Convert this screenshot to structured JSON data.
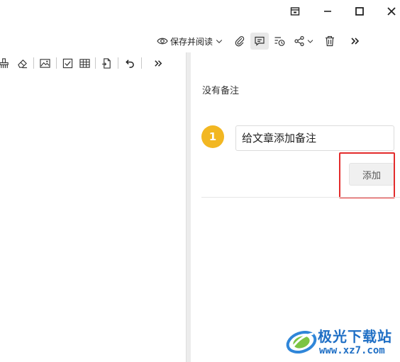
{
  "window_controls": {
    "restore_icon": "window-layout-icon",
    "minimize_icon": "minimize-icon",
    "maximize_icon": "maximize-icon",
    "close_icon": "close-icon"
  },
  "toolbar": {
    "save_and_read_label": "保存并阅读",
    "icons": [
      "eye-icon",
      "chevron-down-icon",
      "attachment-icon",
      "comment-icon",
      "history-icon",
      "share-icon",
      "trash-icon",
      "more-icon"
    ]
  },
  "notes_panel": {
    "empty_text": "没有备注",
    "badge_number": "1",
    "input_placeholder": "给文章添加备注",
    "add_button_label": "添加"
  },
  "watermark": {
    "title": "极光下载站",
    "url": "www.xz7.com"
  },
  "colors": {
    "badge": "#f2b722",
    "highlight": "#e32b2b",
    "watermark": "#1f6fc5"
  }
}
